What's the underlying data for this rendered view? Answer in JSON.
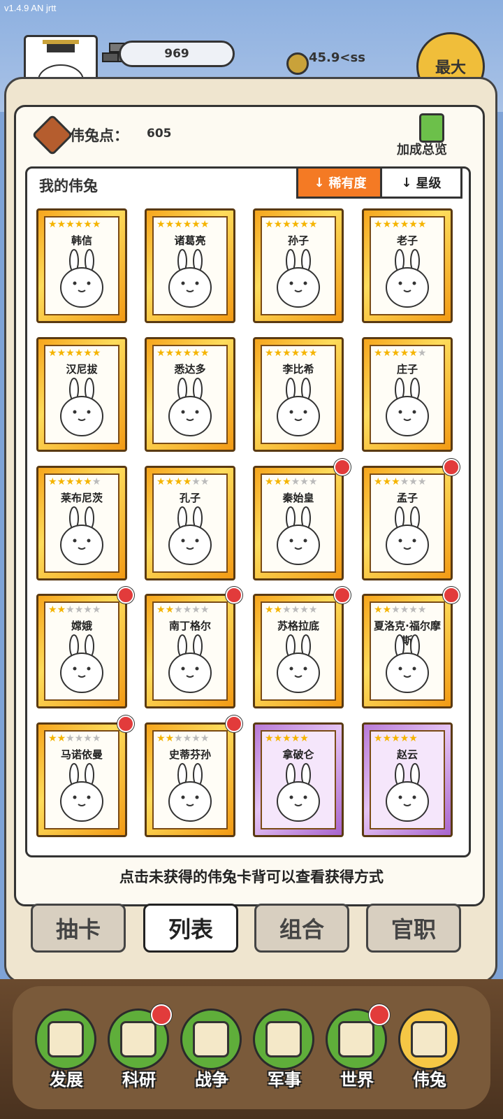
{
  "version": "v1.4.9 AN jrtt",
  "header": {
    "bricks": "969",
    "coins": "45.9<ss",
    "max_button": "最大"
  },
  "points": {
    "label": "伟兔点：",
    "value": "605"
  },
  "bonus_label": "加成总览",
  "list_title": "我的伟兔",
  "sort": {
    "rarity": "稀有度",
    "star": "星级",
    "active": "rarity"
  },
  "cards": [
    {
      "name": "韩信",
      "stars": 6,
      "max": 6,
      "frame": "gold",
      "badge": false
    },
    {
      "name": "诸葛亮",
      "stars": 6,
      "max": 6,
      "frame": "gold",
      "badge": false
    },
    {
      "name": "孙子",
      "stars": 6,
      "max": 6,
      "frame": "gold",
      "badge": false
    },
    {
      "name": "老子",
      "stars": 6,
      "max": 6,
      "frame": "gold",
      "badge": false
    },
    {
      "name": "汉尼拔",
      "stars": 6,
      "max": 6,
      "frame": "gold",
      "badge": false
    },
    {
      "name": "悉达多",
      "stars": 6,
      "max": 6,
      "frame": "gold",
      "badge": false
    },
    {
      "name": "李比希",
      "stars": 6,
      "max": 6,
      "frame": "gold",
      "badge": false
    },
    {
      "name": "庄子",
      "stars": 5,
      "max": 6,
      "frame": "gold",
      "badge": false
    },
    {
      "name": "莱布尼茨",
      "stars": 5,
      "max": 6,
      "frame": "gold",
      "badge": false
    },
    {
      "name": "孔子",
      "stars": 4,
      "max": 6,
      "frame": "gold",
      "badge": false
    },
    {
      "name": "秦始皇",
      "stars": 3,
      "max": 6,
      "frame": "gold",
      "badge": true
    },
    {
      "name": "孟子",
      "stars": 3,
      "max": 6,
      "frame": "gold",
      "badge": true
    },
    {
      "name": "嫦娥",
      "stars": 2,
      "max": 6,
      "frame": "gold",
      "badge": true
    },
    {
      "name": "南丁格尔",
      "stars": 2,
      "max": 6,
      "frame": "gold",
      "badge": true
    },
    {
      "name": "苏格拉底",
      "stars": 2,
      "max": 6,
      "frame": "gold",
      "badge": true
    },
    {
      "name": "夏洛克·福尔摩斯",
      "stars": 2,
      "max": 6,
      "frame": "gold",
      "badge": true
    },
    {
      "name": "马诺依曼",
      "stars": 2,
      "max": 6,
      "frame": "gold",
      "badge": true
    },
    {
      "name": "史蒂芬孙",
      "stars": 2,
      "max": 6,
      "frame": "gold",
      "badge": true
    },
    {
      "name": "拿破仑",
      "stars": 5,
      "max": 5,
      "frame": "purple",
      "badge": false
    },
    {
      "name": "赵云",
      "stars": 5,
      "max": 5,
      "frame": "purple",
      "badge": false
    }
  ],
  "hint": "点击未获得的伟兔卡背可以查看获得方式",
  "tabs": [
    "抽卡",
    "列表",
    "组合",
    "官职"
  ],
  "active_tab": 1,
  "nav": [
    {
      "label": "发展",
      "icon": "growth-icon",
      "badge": false
    },
    {
      "label": "科研",
      "icon": "flask-icon",
      "badge": true
    },
    {
      "label": "战争",
      "icon": "swords-icon",
      "badge": false
    },
    {
      "label": "军事",
      "icon": "helmet-icon",
      "badge": false
    },
    {
      "label": "世界",
      "icon": "globe-icon",
      "badge": true
    },
    {
      "label": "伟兔",
      "icon": "rabbit-card-icon",
      "badge": false
    }
  ],
  "active_nav": 5,
  "colors": {
    "accent": "#f47a24",
    "badge": "#e23b3b",
    "gold_frame": "#f6a51c",
    "purple_frame": "#b879d6"
  }
}
